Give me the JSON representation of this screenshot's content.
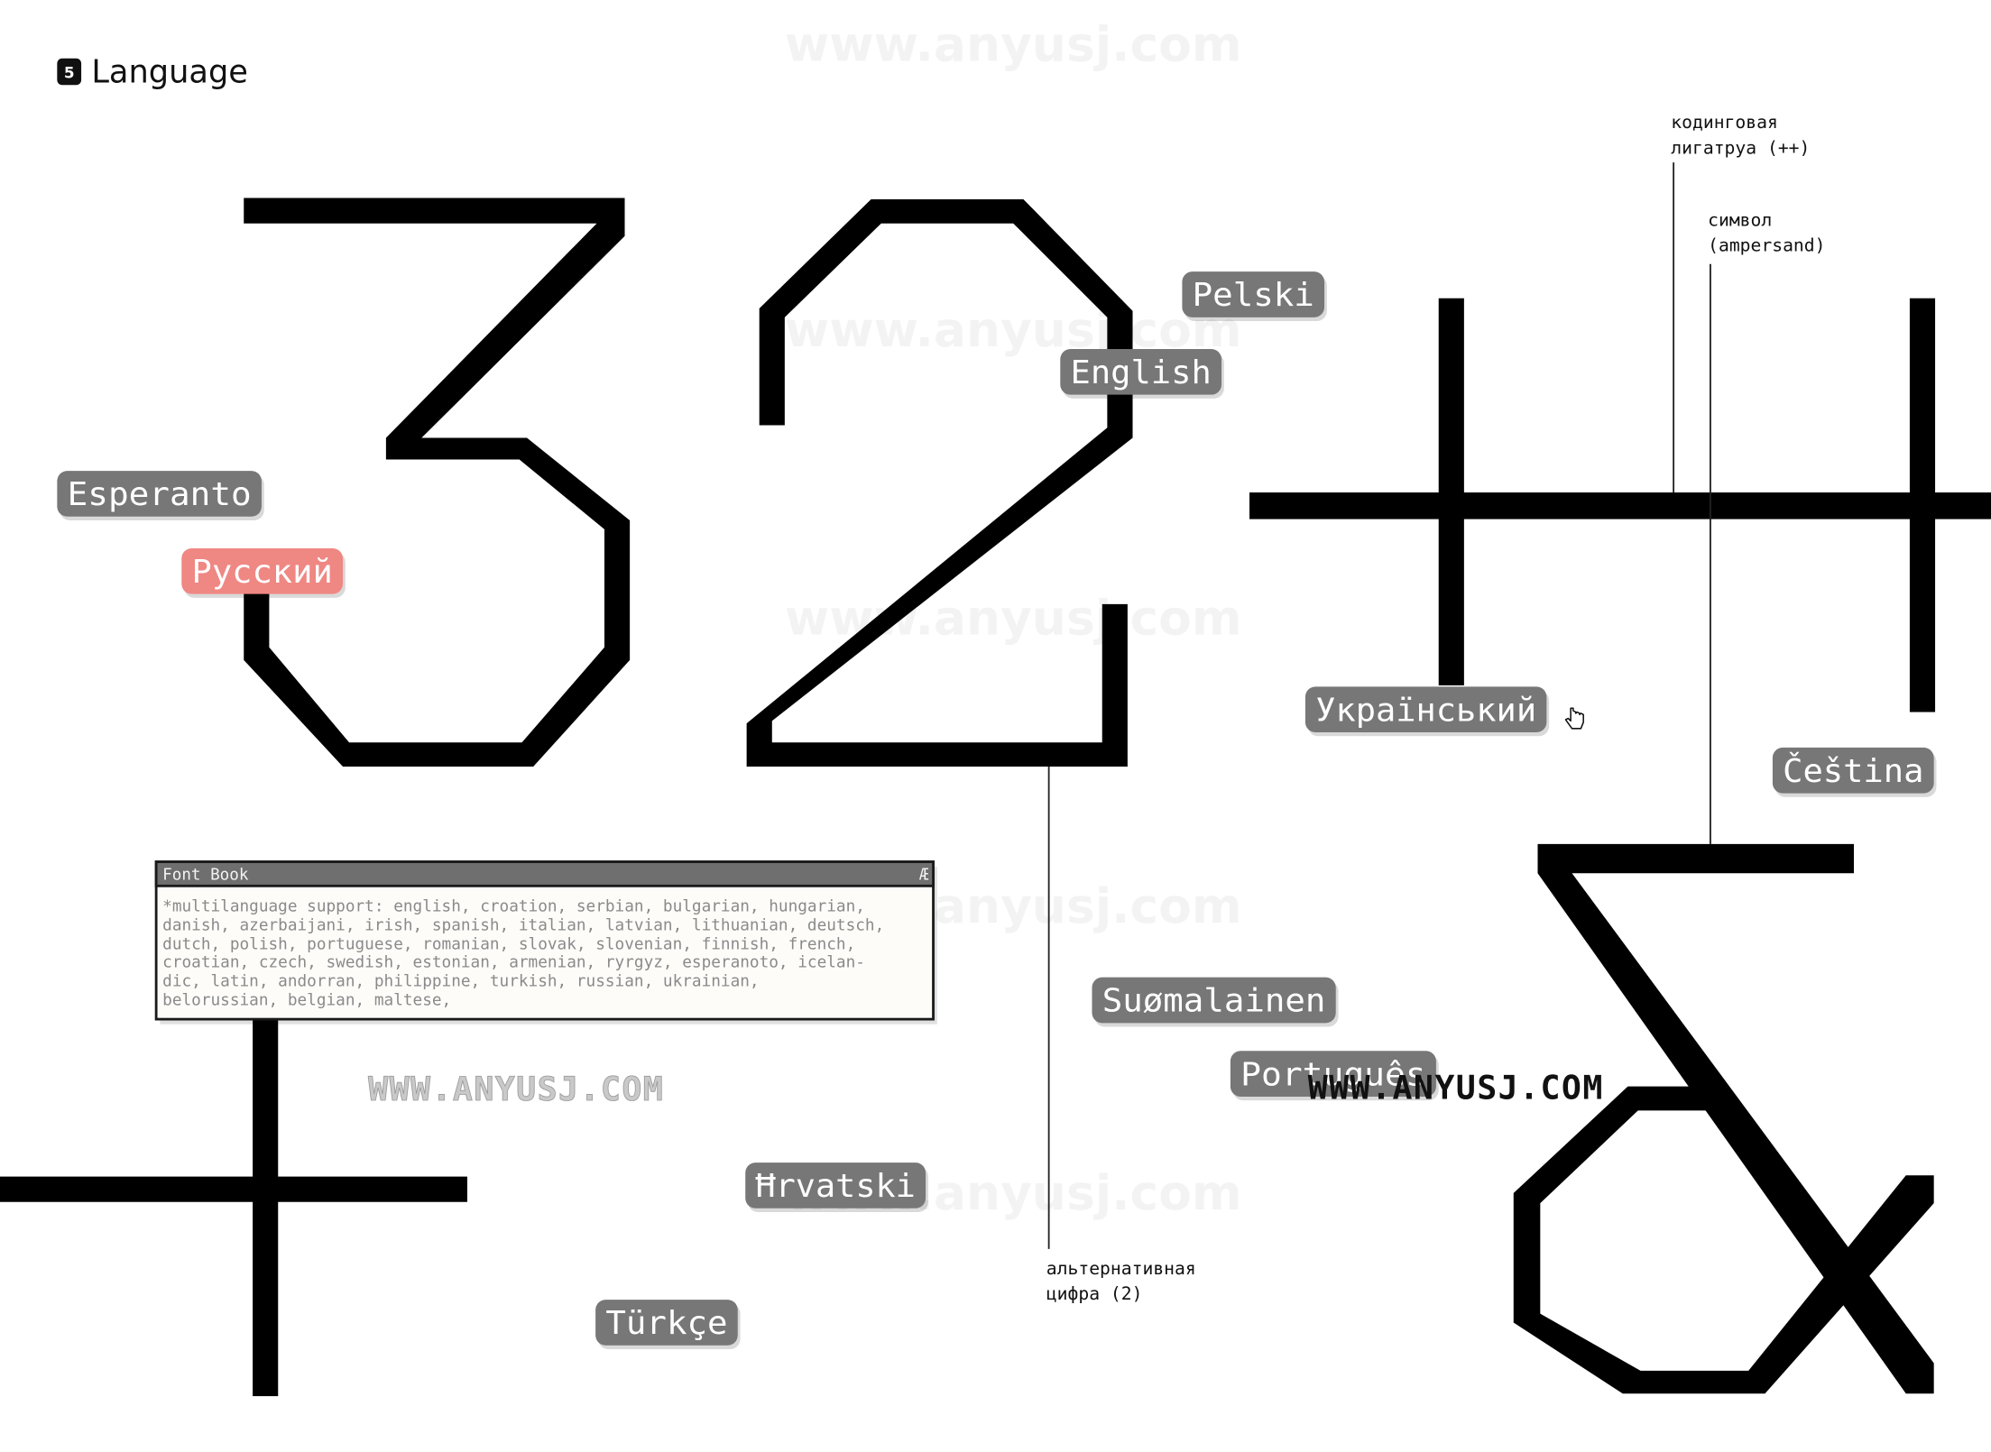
{
  "header": {
    "badge_number": "5",
    "title": "Language"
  },
  "colors": {
    "pill_default": "#777777",
    "pill_highlight": "#ef8783",
    "pill_text": "#ffffff",
    "glyph": "#000000",
    "font_book_titlebar": "#6f6f6f",
    "font_book_body_bg": "#fdfcf9",
    "font_book_text": "#8a8a8a",
    "watermark_dark": "#111111",
    "watermark_light": "#c9c9c9"
  },
  "specimen_glyphs": [
    "3",
    "2",
    "++",
    "&",
    "+"
  ],
  "languages": [
    {
      "id": "pelski",
      "label": "Pelski",
      "highlighted": false
    },
    {
      "id": "english",
      "label": "English",
      "highlighted": false
    },
    {
      "id": "esperanto",
      "label": "Esperanto",
      "highlighted": false
    },
    {
      "id": "russian",
      "label": "Русский",
      "highlighted": true
    },
    {
      "id": "ukrainian",
      "label": "Український",
      "highlighted": false
    },
    {
      "id": "cestina",
      "label": "Čeština",
      "highlighted": false
    },
    {
      "id": "suomalainen",
      "label": "Suømalainen",
      "highlighted": false
    },
    {
      "id": "portugues",
      "label": "Português",
      "highlighted": false
    },
    {
      "id": "hrvatski",
      "label": "Ħrvatski",
      "highlighted": false
    },
    {
      "id": "turkce",
      "label": "Türkçe",
      "highlighted": false
    }
  ],
  "annotations": {
    "ligature": {
      "line1": "кодинговая",
      "line2": "лигатруа (++)"
    },
    "ampersand": {
      "line1": "символ",
      "line2": "(ampersand)"
    },
    "alt_digit": {
      "line1": "альтернативная",
      "line2": "цифра (2)"
    }
  },
  "font_book": {
    "title": "Font Book",
    "title_icon": "Æ",
    "lines": [
      "*multilanguage support: english, croation, serbian, bulgarian, hungarian,",
      "danish, azerbaijani, irish, spanish, italian, latvian, lithuanian, deutsch,",
      "dutch, polish, portuguese, romanian, slovak, slovenian, finnish, french,",
      "croatian, czech, swedish, estonian, armenian, ryrgyz, esperanoto, icelan-",
      "dic, latin, andorran, philippine, turkish, russian, ukrainian,",
      "belorussian, belgian, maltese,"
    ]
  },
  "watermarks": {
    "stylized": "WWW.ANYUSJ.COM",
    "faint": "www.anyusj.com"
  }
}
